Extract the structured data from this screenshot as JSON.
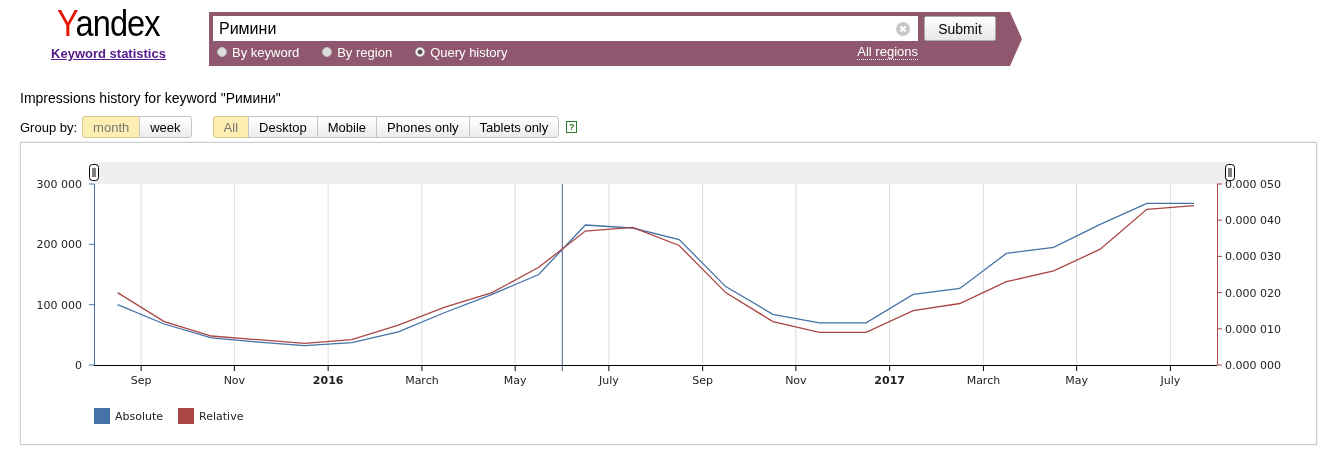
{
  "logo": {
    "text": "Yandex",
    "subtitle": "Keyword statistics"
  },
  "search": {
    "value": "Римини",
    "submit": "Submit",
    "region": "All regions",
    "modes": [
      {
        "label": "By keyword",
        "selected": false
      },
      {
        "label": "By region",
        "selected": false
      },
      {
        "label": "Query history",
        "selected": true
      }
    ]
  },
  "heading": "Impressions history for keyword \"Римини\"",
  "group_by": {
    "label": "Group by:",
    "options": [
      {
        "label": "month",
        "selected": true
      },
      {
        "label": "week",
        "selected": false
      }
    ]
  },
  "devices": [
    {
      "label": "All",
      "selected": true
    },
    {
      "label": "Desktop",
      "selected": false
    },
    {
      "label": "Mobile",
      "selected": false
    },
    {
      "label": "Phones only",
      "selected": false
    },
    {
      "label": "Tablets only",
      "selected": false
    }
  ],
  "help": "?",
  "chart": {
    "chart_data": {
      "type": "line",
      "grid": true,
      "ref_lines": [
        {
          "axis": "x",
          "value": 2016.417,
          "color": "#4a5f80"
        }
      ],
      "x": [
        2015.625,
        2015.708,
        2015.792,
        2015.875,
        2015.958,
        2016.042,
        2016.125,
        2016.208,
        2016.292,
        2016.375,
        2016.458,
        2016.542,
        2016.625,
        2016.708,
        2016.792,
        2016.875,
        2016.958,
        2017.042,
        2017.125,
        2017.208,
        2017.292,
        2017.375,
        2017.458,
        2017.542
      ],
      "xlim": [
        2015.583,
        2017.583
      ],
      "xticks": [
        {
          "value": 2015.667,
          "label": "Sep"
        },
        {
          "value": 2015.833,
          "label": "Nov"
        },
        {
          "value": 2016,
          "label": "2016"
        },
        {
          "value": 2016.167,
          "label": "March"
        },
        {
          "value": 2016.333,
          "label": "May"
        },
        {
          "value": 2016.5,
          "label": "July"
        },
        {
          "value": 2016.667,
          "label": "Sep"
        },
        {
          "value": 2016.833,
          "label": "Nov"
        },
        {
          "value": 2017,
          "label": "2017"
        },
        {
          "value": 2017.167,
          "label": "March"
        },
        {
          "value": 2017.333,
          "label": "May"
        },
        {
          "value": 2017.5,
          "label": "July"
        }
      ],
      "ylim": [
        0,
        300000
      ],
      "yticks": [
        {
          "value": 0,
          "label": "0"
        },
        {
          "value": 100000,
          "label": "100 000"
        },
        {
          "value": 200000,
          "label": "200 000"
        },
        {
          "value": 300000,
          "label": "300 000"
        }
      ],
      "y2lim": [
        0,
        5e-05
      ],
      "y2ticks": [
        {
          "value": 0,
          "label": "0.000 000"
        },
        {
          "value": 1e-05,
          "label": "0.000 010"
        },
        {
          "value": 2e-05,
          "label": "0.000 020"
        },
        {
          "value": 3e-05,
          "label": "0.000 030"
        },
        {
          "value": 4e-05,
          "label": "0.000 040"
        },
        {
          "value": 5e-05,
          "label": "0.000 050"
        }
      ],
      "series": [
        {
          "name": "Absolute",
          "color": "#4572a7",
          "values": [
            100000,
            68000,
            45000,
            38000,
            32000,
            37000,
            55000,
            87000,
            117000,
            150000,
            232000,
            227000,
            208000,
            130000,
            84000,
            70000,
            70000,
            117000,
            127000,
            185000,
            195000,
            233000,
            268000,
            268000
          ]
        },
        {
          "name": "Relative",
          "color": "#aa4643",
          "axis": "y2",
          "values": [
            2e-05,
            1.2e-05,
            8e-06,
            7e-06,
            6e-06,
            7e-06,
            1.1e-05,
            1.6e-05,
            2e-05,
            2.7e-05,
            3.7e-05,
            3.8e-05,
            3.3e-05,
            2e-05,
            1.2e-05,
            9e-06,
            9e-06,
            1.5e-05,
            1.7e-05,
            2.3e-05,
            2.6e-05,
            3.2e-05,
            4.3e-05,
            4.4e-05
          ]
        }
      ]
    }
  }
}
